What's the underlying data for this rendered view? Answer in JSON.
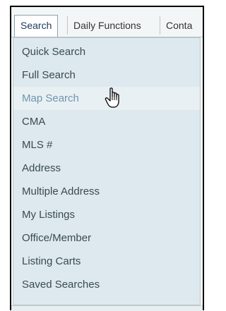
{
  "tabs": [
    {
      "label": "Search",
      "active": true
    },
    {
      "label": "Daily Functions",
      "active": false
    },
    {
      "label": "Conta",
      "active": false
    }
  ],
  "menu": {
    "items": [
      {
        "label": "Quick Search"
      },
      {
        "label": "Full Search"
      },
      {
        "label": "Map Search",
        "hovered": true
      },
      {
        "label": "CMA"
      },
      {
        "label": "MLS #"
      },
      {
        "label": "Address"
      },
      {
        "label": "Multiple Address"
      },
      {
        "label": "My Listings"
      },
      {
        "label": "Office/Member"
      },
      {
        "label": "Listing Carts"
      },
      {
        "label": "Saved Searches"
      }
    ]
  },
  "cursor": {
    "icon": "hand-pointer-icon"
  },
  "colors": {
    "menu_bg": "#dde9ee",
    "hover_bg": "#e8f0f3",
    "hover_text": "#6f95ad",
    "item_text": "#3a4a52",
    "tab_border": "#8aa3ad"
  }
}
